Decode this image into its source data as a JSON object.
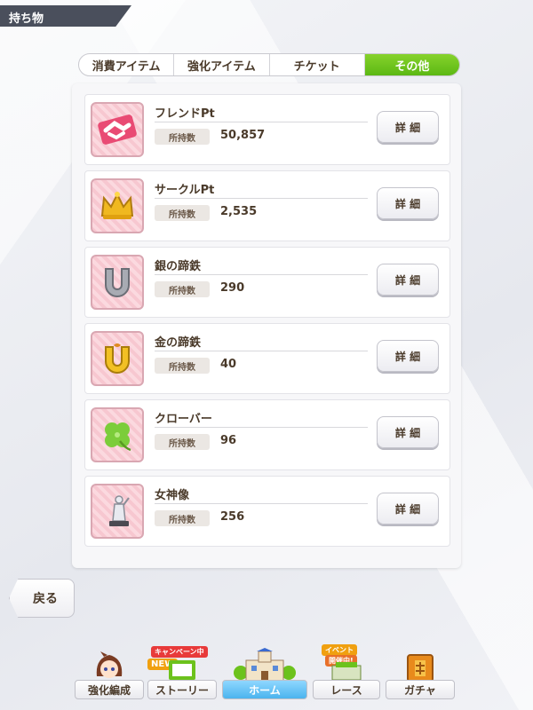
{
  "header": {
    "title": "持ち物"
  },
  "tabs": [
    {
      "label": "消費アイテム",
      "active": false
    },
    {
      "label": "強化アイテム",
      "active": false
    },
    {
      "label": "チケット",
      "active": false
    },
    {
      "label": "その他",
      "active": true
    }
  ],
  "items": [
    {
      "name": "フレンドPt",
      "qty_label": "所持数",
      "qty": "50,857",
      "detail": "詳 細",
      "icon": "handshake-icon"
    },
    {
      "name": "サークルPt",
      "qty_label": "所持数",
      "qty": "2,535",
      "detail": "詳 細",
      "icon": "crown-icon"
    },
    {
      "name": "銀の蹄鉄",
      "qty_label": "所持数",
      "qty": "290",
      "detail": "詳 細",
      "icon": "silver-horseshoe-icon"
    },
    {
      "name": "金の蹄鉄",
      "qty_label": "所持数",
      "qty": "40",
      "detail": "詳 細",
      "icon": "gold-horseshoe-icon"
    },
    {
      "name": "クローバー",
      "qty_label": "所持数",
      "qty": "96",
      "detail": "詳 細",
      "icon": "clover-icon"
    },
    {
      "name": "女神像",
      "qty_label": "所持数",
      "qty": "256",
      "detail": "詳 細",
      "icon": "goddess-statue-icon"
    }
  ],
  "back_button": {
    "label": "戻る"
  },
  "nav": {
    "items": [
      {
        "label": "強化編成",
        "icon": "character-icon"
      },
      {
        "label": "ストーリー",
        "icon": "story-icon",
        "badge_campaign": "キャンペーン中",
        "badge_new": "NEW"
      },
      {
        "label": "ホーム",
        "icon": "home-building-icon"
      },
      {
        "label": "レース",
        "icon": "race-icon",
        "badge_event_1": "イベント",
        "badge_event_2": "開催中!"
      },
      {
        "label": "ガチャ",
        "icon": "gacha-icon"
      }
    ]
  },
  "colors": {
    "active_tab": "#6cc21c",
    "header_bg": "#4a4f5c",
    "icon_bg": "#f7c7d0",
    "text": "#4a3a2a"
  }
}
